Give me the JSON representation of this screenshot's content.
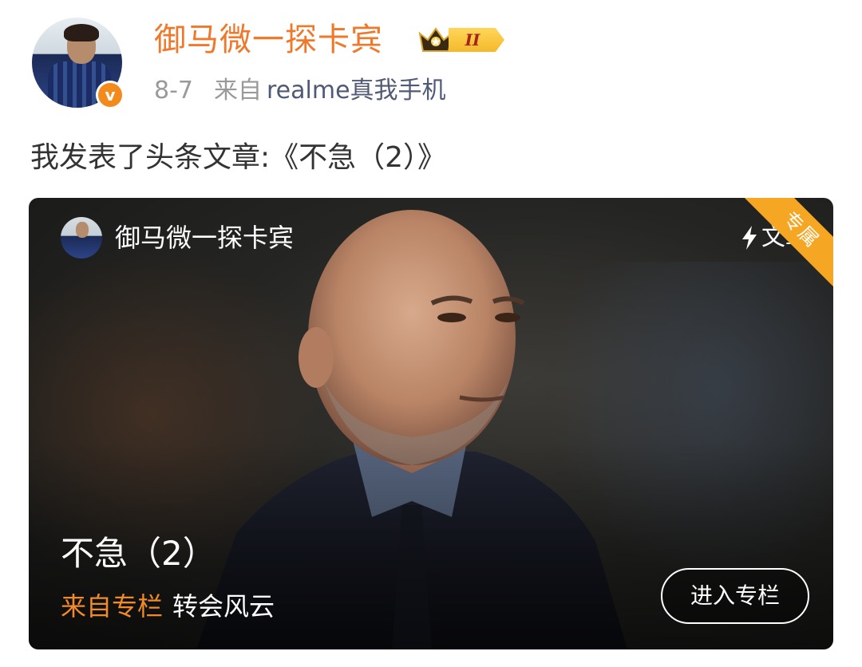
{
  "user": {
    "name": "御马微一探卡宾",
    "level_badge": "II",
    "verified_mark": "v"
  },
  "meta": {
    "date": "8-7",
    "source_prefix": "来自",
    "device": "realme真我手机"
  },
  "post": {
    "text": "我发表了头条文章:《不急（2）》"
  },
  "article_card": {
    "author": "御马微一探卡宾",
    "type_label": "文章",
    "ribbon_label": "专属",
    "title": "不急（2）",
    "source_prefix": "来自专栏",
    "column_name": "转会风云",
    "enter_button": "进入专栏"
  },
  "colors": {
    "username": "#f0782a",
    "accent_orange": "#f08a2a",
    "ribbon": "#f5a623",
    "device_link": "#505a76"
  }
}
